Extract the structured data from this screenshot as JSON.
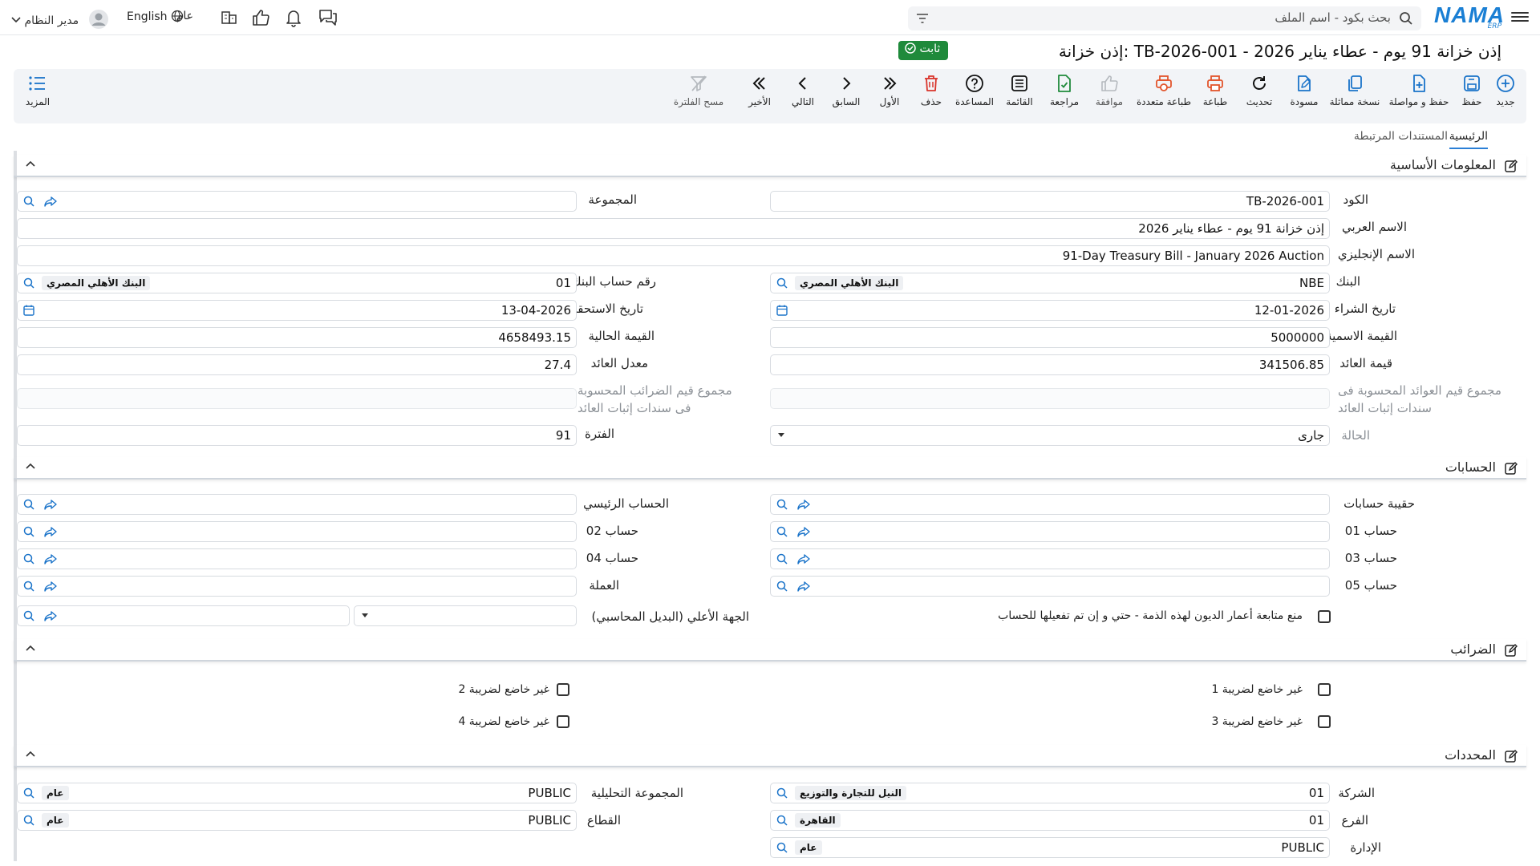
{
  "header": {
    "search_placeholder": "بحث بكود - اسم الملف",
    "logo_text": "NAMA",
    "logo_sub": "ERP",
    "public_label": "عام",
    "language": "English",
    "user_name": "مدير النظام"
  },
  "page": {
    "title": "إذن خزانة: TB-2026-001 - إذن خزانة 91 يوم - عطاء يناير 2026",
    "status_badge": "ثابت"
  },
  "toolbar": {
    "new": "جديد",
    "save": "حفظ",
    "save_continue": "حفظ و مواصلة",
    "duplicate": "نسخة مماثلة",
    "draft": "مسودة",
    "refresh": "تحديث",
    "print": "طباعة",
    "multi_print": "طباعة متعددة",
    "approve": "موافقة",
    "review": "مراجعة",
    "list": "القائمة",
    "help": "المساعدة",
    "delete": "حذف",
    "first": "الأول",
    "previous": "السابق",
    "next": "التالي",
    "last": "الأخير",
    "clear_filter": "مسح الفلترة",
    "more": "المزيد"
  },
  "tabs": {
    "main": "الرئيسية",
    "related": "المستندات المرتبطة"
  },
  "basic": {
    "title": "المعلومات الأساسية",
    "code_label": "الكود",
    "code": "TB-2026-001",
    "group_label": "المجموعة",
    "arabic_name_label": "الاسم العربي",
    "arabic_name": "إذن خزانة 91 يوم - عطاء يناير 2026",
    "english_name_label": "الاسم الإنجليزي",
    "english_name": "91-Day Treasury Bill - January 2026 Auction",
    "bank_label": "البنك",
    "bank_code": "NBE",
    "bank_name": "البنك الأهلي المصري",
    "bank_account_label": "رقم حساب البنك",
    "bank_account_code": "01",
    "bank_account_name": "البنك الأهلي المصري",
    "purchase_date_label": "تاريخ الشراء",
    "purchase_date": "12-01-2026",
    "maturity_date_label": "تاريخ الاستحقاق",
    "maturity_date": "13-04-2026",
    "face_value_label": "القيمة الاسمية",
    "face_value": "5000000",
    "present_value_label": "القيمة الحالية",
    "present_value": "4658493.15",
    "yield_value_label": "قيمة العائد",
    "yield_value": "341506.85",
    "yield_rate_label": "معدل العائد",
    "yield_rate": "27.4",
    "calc_yields_label": "مجموع قيم العوائد المحسوبة فى سندات إثبات العائد",
    "calc_taxes_label": "مجموع قيم الضرائب المحسوبة فى سندات إثبات العائد",
    "status_label": "الحالة",
    "status": "جارى",
    "period_label": "الفترة",
    "period": "91"
  },
  "accounts": {
    "title": "الحسابات",
    "portfolio_label": "حقيبة حسابات",
    "main_account_label": "الحساب الرئيسي",
    "acc01_label": "حساب 01",
    "acc02_label": "حساب 02",
    "acc03_label": "حساب 03",
    "acc04_label": "حساب 04",
    "acc05_label": "حساب 05",
    "currency_label": "العملة",
    "prevent_debt_label": "منع متابعة أعمار الديون لهذه الذمة - حتي و إن تم تفعيلها للحساب",
    "parent_label": "الجهة الأعلي (البديل المحاسبي)"
  },
  "taxes": {
    "title": "الضرائب",
    "tax1": "غير خاضع لضريبة 1",
    "tax2": "غير خاضع لضريبة 2",
    "tax3": "غير خاضع لضريبة 3",
    "tax4": "غير خاضع لضريبة 4"
  },
  "dimensions": {
    "title": "المحددات",
    "company_label": "الشركة",
    "company_code": "01",
    "company_name": "النيل للتجارة والتوزيع",
    "analytic_group_label": "المجموعة التحليلية",
    "analytic_group_code": "PUBLIC",
    "analytic_group_name": "عام",
    "branch_label": "الفرع",
    "branch_code": "01",
    "branch_name": "القاهرة",
    "sector_label": "القطاع",
    "sector_code": "PUBLIC",
    "sector_name": "عام",
    "department_label": "الإدارة",
    "department_code": "PUBLIC",
    "department_name": "عام"
  }
}
